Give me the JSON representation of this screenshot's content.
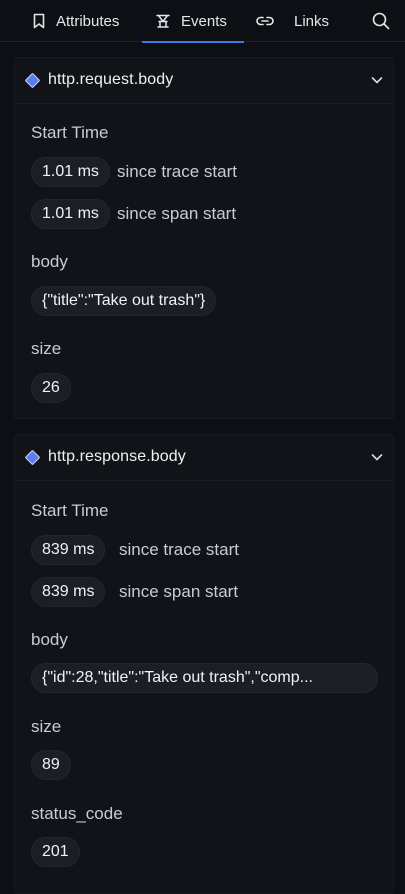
{
  "tabs": [
    {
      "label": "Attributes",
      "icon": "bookmark-icon"
    },
    {
      "label": "Events",
      "icon": "events-icon",
      "active": true
    },
    {
      "label": "Links",
      "icon": "link-icon"
    }
  ],
  "accent_color": "#3b78e7",
  "event_marker_color": "#5b7cf0",
  "events": [
    {
      "name": "http.request.body",
      "start_time_label": "Start Time",
      "since_trace_value": "1.01 ms",
      "since_trace_label": "since trace start",
      "since_span_value": "1.01 ms",
      "since_span_label": "since span start",
      "attributes": [
        {
          "key": "body",
          "value": "{\"title\":\"Take out trash\"}"
        },
        {
          "key": "size",
          "value": "26"
        }
      ]
    },
    {
      "name": "http.response.body",
      "start_time_label": "Start Time",
      "since_trace_value": "839 ms",
      "since_trace_label": "since trace start",
      "since_span_value": "839 ms",
      "since_span_label": "since span start",
      "attributes": [
        {
          "key": "body",
          "value": "{\"id\":28,\"title\":\"Take out trash\",\"comp..."
        },
        {
          "key": "size",
          "value": "89"
        },
        {
          "key": "status_code",
          "value": "201"
        }
      ]
    }
  ]
}
